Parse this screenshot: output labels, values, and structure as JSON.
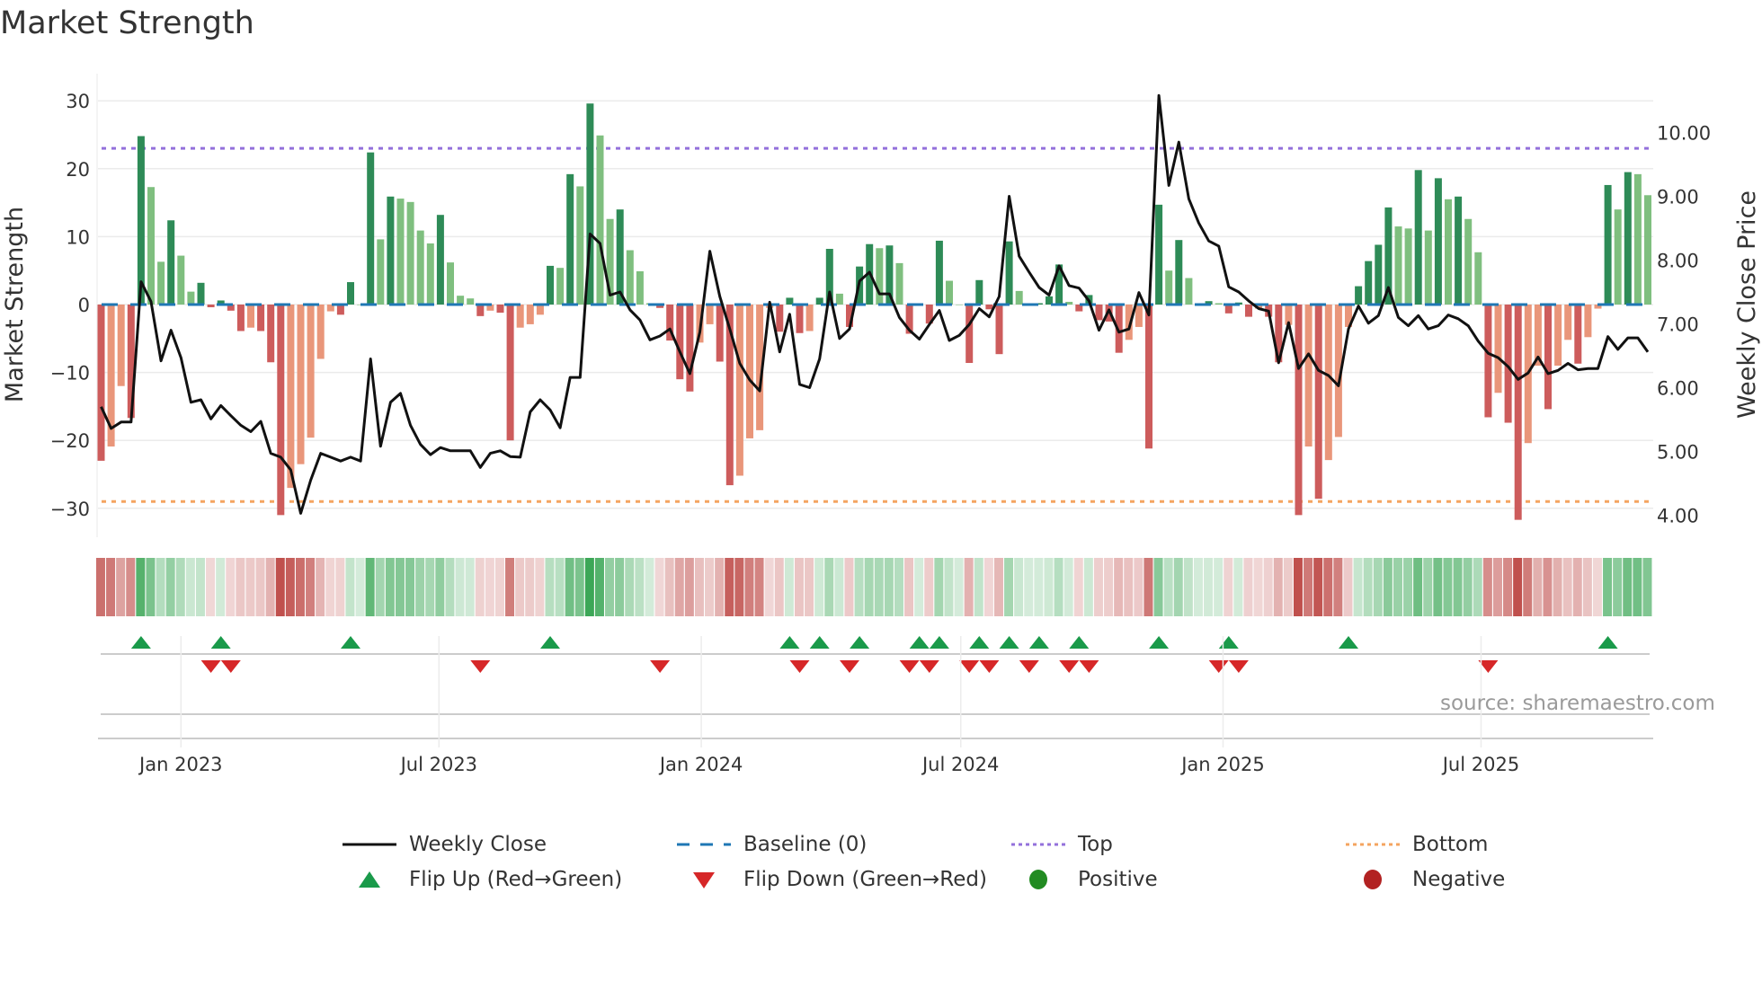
{
  "title": "Market Strength",
  "source": "source: sharemaestro.com",
  "legend": {
    "weekly_close": "Weekly Close",
    "baseline": "Baseline (0)",
    "top": "Top",
    "bottom": "Bottom",
    "flip_up": "Flip Up (Red→Green)",
    "flip_down": "Flip Down (Green→Red)",
    "positive": "Positive",
    "negative": "Negative"
  },
  "colors": {
    "pos_rising": "#2e8b57",
    "pos_falling": "#7fbf7f",
    "neg_falling": "#cd5c5c",
    "neg_rising": "#e9967a",
    "close": "#111111",
    "baseline": "#1f77b4",
    "top": "#9370db",
    "bottom": "#f4a460",
    "flip_up": "#1a9a4a",
    "flip_down": "#d62728",
    "positive": "#228b22",
    "negative": "#b22222"
  },
  "chart_data": {
    "type": "bar+line",
    "title": "Market Strength",
    "ylabel": "Market Strength",
    "y2label": "Weekly Close Price",
    "ylim": [
      -33,
      33
    ],
    "y2lim": [
      3.79,
      10.96
    ],
    "yticks": [
      -30,
      -20,
      -10,
      0,
      10,
      20,
      30
    ],
    "yticklabels": [
      "−30",
      "−20",
      "−10",
      "0",
      "10",
      "20",
      "30"
    ],
    "y2ticks": [
      4,
      5,
      6,
      7,
      8,
      9,
      10
    ],
    "y2ticklabels": [
      "4.00",
      "5.00",
      "6.00",
      "7.00",
      "8.00",
      "9.00",
      "10.00"
    ],
    "start_week": "2022-11-06",
    "xticks": [
      {
        "date": "2023-01-01",
        "label": "Jan 2023"
      },
      {
        "date": "2023-07-01",
        "label": "Jul 2023"
      },
      {
        "date": "2024-01-01",
        "label": "Jan 2024"
      },
      {
        "date": "2024-07-01",
        "label": "Jul 2024"
      },
      {
        "date": "2025-01-01",
        "label": "Jan 2025"
      },
      {
        "date": "2025-07-01",
        "label": "Jul 2025"
      }
    ],
    "top_level": 23,
    "bottom_level": -29,
    "baseline": 0,
    "strength": [
      -23,
      -20.9,
      -12,
      -16.7,
      24.8,
      17.3,
      6.3,
      12.4,
      7.2,
      1.9,
      3.2,
      -0.4,
      0.6,
      -0.9,
      -3.9,
      -3.4,
      -3.9,
      -8.5,
      -31,
      -27,
      -23.5,
      -19.6,
      -8,
      -1,
      -1.5,
      3.3,
      0,
      22.4,
      9.6,
      15.9,
      15.6,
      15.1,
      10.9,
      9,
      13.2,
      6.2,
      1.3,
      0.9,
      -1.7,
      -0.9,
      -1.2,
      -20,
      -3.4,
      -2.9,
      -1.5,
      5.7,
      5.4,
      19.2,
      17.4,
      29.6,
      24.9,
      12.6,
      14,
      8,
      4.9,
      0.2,
      -0.5,
      -5.3,
      -11,
      -12.8,
      -5.6,
      -2.9,
      -8.4,
      -26.6,
      -25.2,
      -19.7,
      -18.5,
      -0.5,
      -4,
      1,
      -4.2,
      -3.9,
      1,
      8.2,
      1.6,
      -3.3,
      5.6,
      8.9,
      8.3,
      8.7,
      6.1,
      -4.3,
      0,
      -2.8,
      9.4,
      3.5,
      0,
      -8.6,
      3.6,
      -0.7,
      -7.3,
      9.3,
      2,
      0,
      0.2,
      1.2,
      5.9,
      0.4,
      -1,
      1.4,
      -2.3,
      -2.5,
      -7.1,
      -5.2,
      -3.3,
      -21.2,
      14.7,
      5,
      9.5,
      3.9,
      0.1,
      0.5,
      0.2,
      -1.3,
      0.3,
      -1.8,
      -0.6,
      -1.8,
      -8.5,
      -3,
      -31,
      -20.9,
      -28.6,
      -22.9,
      -19.5,
      -3.3,
      2.7,
      6.4,
      8.8,
      14.3,
      11.5,
      11.2,
      19.8,
      10.9,
      18.6,
      15.5,
      15.9,
      12.6,
      7.7,
      -16.6,
      -13,
      -17.4,
      -31.7,
      -20.4,
      -9,
      -15.4,
      -9,
      -5.2,
      -8.7,
      -4.8,
      -0.6,
      17.6,
      14,
      19.5,
      19.2,
      16.1
    ],
    "weekly_close": [
      5.7,
      5.36,
      5.46,
      5.46,
      7.66,
      7.35,
      6.42,
      6.9,
      6.47,
      5.77,
      5.81,
      5.51,
      5.72,
      5.56,
      5.41,
      5.31,
      5.47,
      4.97,
      4.91,
      4.71,
      4.03,
      4.55,
      4.97,
      4.91,
      4.85,
      4.91,
      4.85,
      6.45,
      5.08,
      5.77,
      5.91,
      5.41,
      5.11,
      4.95,
      5.06,
      5.01,
      5.01,
      5.01,
      4.75,
      4.97,
      5.01,
      4.92,
      4.91,
      5.62,
      5.81,
      5.65,
      5.37,
      6.16,
      6.16,
      8.41,
      8.26,
      7.45,
      7.5,
      7.22,
      7.06,
      6.75,
      6.81,
      6.92,
      6.56,
      6.22,
      6.87,
      8.14,
      7.43,
      6.92,
      6.38,
      6.12,
      5.95,
      7.34,
      6.56,
      7.15,
      6.05,
      6.0,
      6.45,
      7.5,
      6.77,
      6.92,
      7.67,
      7.81,
      7.47,
      7.47,
      7.1,
      6.9,
      6.76,
      6.99,
      7.21,
      6.74,
      6.82,
      6.99,
      7.24,
      7.11,
      7.43,
      9.0,
      8.06,
      7.81,
      7.57,
      7.45,
      7.91,
      7.6,
      7.56,
      7.36,
      6.9,
      7.22,
      6.87,
      6.92,
      7.49,
      7.14,
      10.58,
      9.17,
      9.85,
      8.96,
      8.58,
      8.3,
      8.22,
      7.58,
      7.5,
      7.36,
      7.24,
      7.2,
      6.39,
      7.02,
      6.3,
      6.53,
      6.27,
      6.19,
      6.03,
      6.92,
      7.28,
      7.01,
      7.13,
      7.57,
      7.1,
      6.97,
      7.13,
      6.92,
      6.97,
      7.14,
      7.08,
      6.97,
      6.73,
      6.54,
      6.47,
      6.33,
      6.13,
      6.23,
      6.48,
      6.22,
      6.27,
      6.38,
      6.28,
      6.3,
      6.3,
      6.8,
      6.6,
      6.78,
      6.78,
      6.56
    ],
    "flip_up_weeks": [
      4,
      12,
      25,
      45,
      69,
      72,
      76,
      82,
      84,
      88,
      91,
      94,
      98,
      106,
      113,
      125,
      151
    ],
    "flip_down_weeks": [
      11,
      13,
      38,
      56,
      70,
      75,
      81,
      83,
      87,
      89,
      93,
      97,
      99,
      112,
      114,
      139
    ],
    "legend_position": "bottom"
  }
}
